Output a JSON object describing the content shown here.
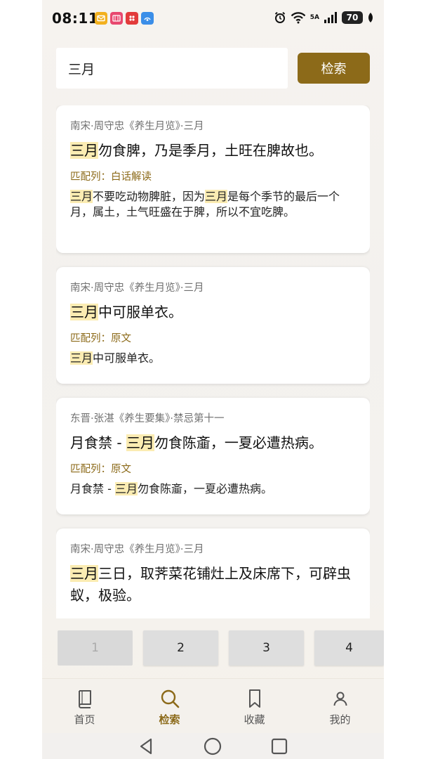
{
  "status": {
    "time": "08:11",
    "network": "5A",
    "battery": "70",
    "colors": {
      "notif1": "#f2b01e",
      "notif2": "#e8486f",
      "notif3": "#e23b3b",
      "notif4": "#3b8ee8"
    }
  },
  "search": {
    "query": "三月",
    "button_label": "检索"
  },
  "results": [
    {
      "meta": "南宋·周守忠《养生月览》·三月",
      "title": [
        {
          "t": "三月",
          "hl": true
        },
        {
          "t": "勿食脾，乃是季月，土旺在脾故也。",
          "hl": false
        }
      ],
      "match_label": "匹配列：白话解读",
      "match": [
        {
          "t": "三月",
          "hl": true
        },
        {
          "t": "不要吃动物脾脏，因为",
          "hl": false
        },
        {
          "t": "三月",
          "hl": true
        },
        {
          "t": "是每个季节的最后一个月，属土，土气旺盛在于脾，所以不宜吃脾。",
          "hl": false
        }
      ]
    },
    {
      "meta": "南宋·周守忠《养生月览》·三月",
      "title": [
        {
          "t": "三月",
          "hl": true
        },
        {
          "t": "中可服单衣。",
          "hl": false
        }
      ],
      "match_label": "匹配列：原文",
      "match": [
        {
          "t": "三月",
          "hl": true
        },
        {
          "t": "中可服单衣。",
          "hl": false
        }
      ]
    },
    {
      "meta": "东晋·张湛《养生要集》·禁忌第十一",
      "title": [
        {
          "t": "月食禁 - ",
          "hl": false
        },
        {
          "t": "三月",
          "hl": true
        },
        {
          "t": "勿食陈齑，一夏必遭热病。",
          "hl": false
        }
      ],
      "match_label": "匹配列：原文",
      "match": [
        {
          "t": "月食禁 - ",
          "hl": false
        },
        {
          "t": "三月",
          "hl": true
        },
        {
          "t": "勿食陈齑，一夏必遭热病。",
          "hl": false
        }
      ]
    },
    {
      "meta": "南宋·周守忠《养生月览》·三月",
      "title": [
        {
          "t": "三月",
          "hl": true
        },
        {
          "t": "三日，取荠菜花铺灶上及床席下，可辟虫蚁，极验。",
          "hl": false
        }
      ],
      "match_label": "",
      "match": []
    }
  ],
  "pagination": {
    "pages": [
      "1",
      "2",
      "3",
      "4"
    ],
    "current": "1"
  },
  "nav": {
    "items": [
      {
        "label": "首页",
        "icon": "book-icon",
        "active": false
      },
      {
        "label": "检索",
        "icon": "search-icon",
        "active": true
      },
      {
        "label": "收藏",
        "icon": "bookmark-icon",
        "active": false
      },
      {
        "label": "我的",
        "icon": "person-icon",
        "active": false
      }
    ],
    "active_color": "#8c6a19",
    "inactive_color": "#555555"
  },
  "theme": {
    "accent": "#8c6a19",
    "highlight": "#fbecb2"
  }
}
